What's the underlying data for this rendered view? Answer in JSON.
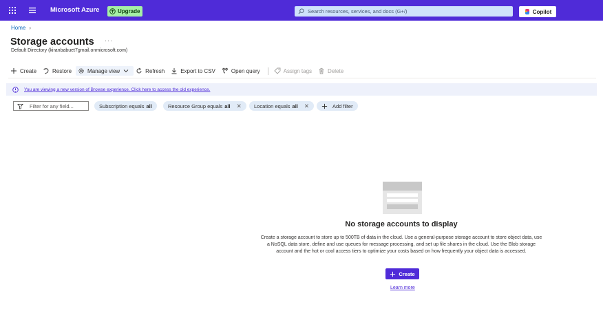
{
  "topbar": {
    "brand": "Microsoft Azure",
    "upgrade_label": "Upgrade",
    "search_placeholder": "Search resources, services, and docs (G+/)",
    "copilot_label": "Copilot",
    "bg_color": "#4f2bd8"
  },
  "breadcrumb": {
    "home": "Home",
    "separator": "›"
  },
  "page": {
    "title": "Storage accounts",
    "more": "···",
    "subtitle": "Default Directory (kiranbabuet7gmail.onmicrosoft.com)"
  },
  "toolbar": {
    "create": "Create",
    "restore": "Restore",
    "manage_view": "Manage view",
    "refresh": "Refresh",
    "export_csv": "Export to CSV",
    "open_query": "Open query",
    "assign_tags": "Assign tags",
    "delete": "Delete"
  },
  "banner": {
    "text": "You are viewing a new version of Browse experience. Click here to access the old experience."
  },
  "filters": {
    "placeholder": "Filter for any field...",
    "subscription": {
      "label": "Subscription equals",
      "value": "all"
    },
    "resource_group": {
      "label": "Resource Group equals",
      "value": "all",
      "remove": "✕"
    },
    "location": {
      "label": "Location equals",
      "value": "all",
      "remove": "✕"
    },
    "add_filter": "Add filter"
  },
  "empty_state": {
    "title": "No storage accounts to display",
    "description": "Create a storage account to store up to 500TB of data in the cloud. Use a general-purpose storage account to store object data, use a NoSQL data store, define and use queues for message processing, and set up file shares in the cloud. Use the Blob storage account and the hot or cool access tiers to optimize your costs based on how frequently your object data is accessed.",
    "create_button": "Create",
    "learn_more": "Learn more"
  },
  "icons": {
    "waffle": "app-launcher-icon",
    "hamburger": "menu-icon",
    "upgrade": "upgrade-icon",
    "search": "search-icon",
    "copilot": "copilot-icon",
    "info": "info-icon",
    "filter": "filter-icon"
  }
}
